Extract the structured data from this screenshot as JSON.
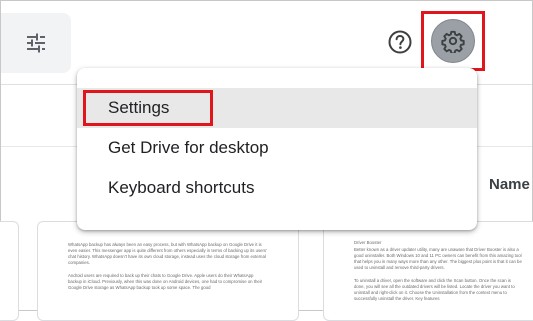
{
  "toolbar": {
    "filter_icon": "tune-icon",
    "help_icon": "help-circle-icon",
    "settings_icon": "gear-icon"
  },
  "menu": {
    "items": [
      {
        "label": "Settings",
        "active": true
      },
      {
        "label": "Get Drive for desktop"
      },
      {
        "label": "Keyboard shortcuts"
      }
    ]
  },
  "file_list": {
    "name_header": "Name"
  },
  "cards": {
    "middle": {
      "paragraphs": [
        "WhatsApp backup has always been an easy process, but with WhatsApp backup on Google Drive it is even easier. This messenger app is quite different from others especially in terms of backing up its users' chat history. WhatsApp doesn't have its own cloud storage, instead uses the cloud storage from external companies.",
        "Android users are required to back up their chats to Google Drive. Apple users do their WhatsApp backup in iCloud. Previously, when this was done on Android devices, one had to compromise on their Google Drive storage as WhatsApp backup took up some space. The good"
      ]
    },
    "right": {
      "paragraphs": [
        "Driver Booster",
        "Better known as a driver updater utility, many are unaware that Driver Booster is also a good uninstaller. Both Windows 10 and 11 PC owners can benefit from this amazing tool that helps you in many ways more than any other. The biggest plus point is that it can be used to uninstall and remove third-party drivers.",
        "To uninstall a driver, open the software and click the Scan button. Once the scan is done, you will see all the outdated drivers will be listed. Locate the driver you want to uninstall and right-click on it. Choose the Uninstallation from the context menu to successfully uninstall the driver. Key features"
      ]
    }
  },
  "colors": {
    "highlight_border": "#e0161d",
    "active_row": "#e8e8e8",
    "settings_button": "#9aa0a6"
  }
}
